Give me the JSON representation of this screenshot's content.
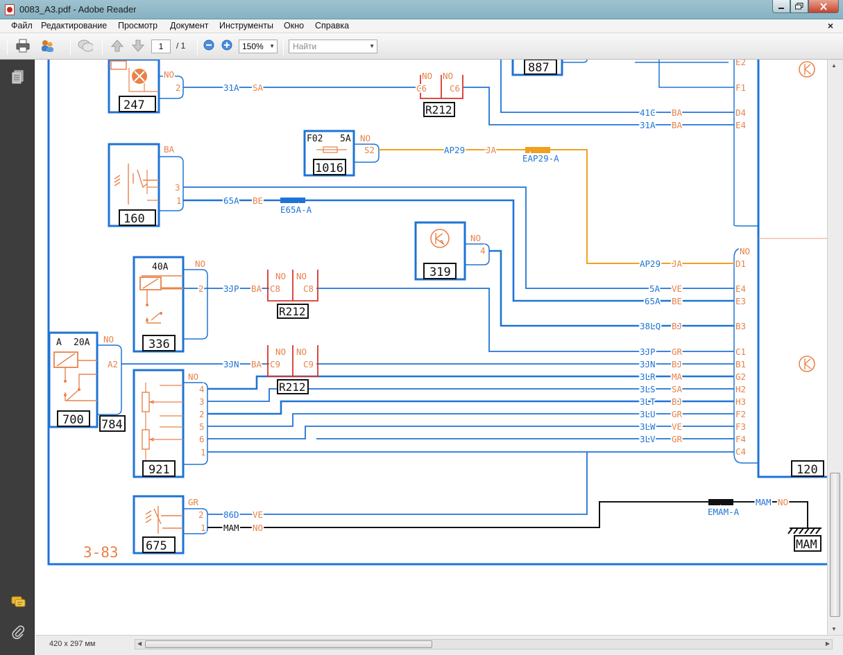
{
  "window": {
    "title": "0083_A3.pdf - Adobe Reader"
  },
  "menu": {
    "items": [
      "Файл",
      "Редактирование",
      "Просмотр",
      "Документ",
      "Инструменты",
      "Окно",
      "Справка"
    ],
    "close_glyph": "×"
  },
  "toolbar": {
    "page_current": "1",
    "page_total": "/ 1",
    "zoom": "150%",
    "search_placeholder": "Найти"
  },
  "status": {
    "page_size": "420 x 297 мм"
  },
  "colors": {
    "blue": "#1e73d6",
    "orange": "#e8824a",
    "wire_orange": "#f0a020",
    "black": "#111111"
  },
  "diagram": {
    "sheet_ref": "3-83",
    "components": [
      {
        "id": "247",
        "label": "247"
      },
      {
        "id": "160",
        "label": "160"
      },
      {
        "id": "1016",
        "label": "1016",
        "fuse": "F02",
        "rating": "5A"
      },
      {
        "id": "319",
        "label": "319"
      },
      {
        "id": "336",
        "label": "336",
        "rating": "40A"
      },
      {
        "id": "700",
        "label": "700",
        "top_left": "A",
        "rating": "20A"
      },
      {
        "id": "784",
        "label": "784"
      },
      {
        "id": "921",
        "label": "921"
      },
      {
        "id": "675",
        "label": "675"
      },
      {
        "id": "887",
        "label": "887"
      },
      {
        "id": "120",
        "label": "120"
      },
      {
        "id": "MAM",
        "label": "MAM"
      }
    ],
    "connectors": [
      {
        "id": "R212-C6",
        "label": "R212",
        "pins": [
          "C6",
          "C6"
        ],
        "colors": [
          "NO",
          "NO"
        ]
      },
      {
        "id": "R212-C8",
        "label": "R212",
        "pins": [
          "C8",
          "C8"
        ],
        "colors": [
          "NO",
          "NO"
        ]
      },
      {
        "id": "R212-C9",
        "label": "R212",
        "pins": [
          "C9",
          "C9"
        ],
        "colors": [
          "NO",
          "NO"
        ]
      }
    ],
    "wires": [
      {
        "code": "31A",
        "color": "SA",
        "to": "E4"
      },
      {
        "code": "41C",
        "color": "BA",
        "to": "D4"
      },
      {
        "code": "31A",
        "color": "BA",
        "to": "E4"
      },
      {
        "code": "AP29",
        "color": "JA",
        "splice": "EAP29-A"
      },
      {
        "code": "65A",
        "color": "BE",
        "splice": "E65A-A"
      },
      {
        "code": "AP29",
        "color": "JA",
        "to": "D1"
      },
      {
        "code": "5A",
        "color": "VE",
        "to": "E4"
      },
      {
        "code": "65A",
        "color": "BE",
        "to": "E3"
      },
      {
        "code": "38LQ",
        "color": "BJ",
        "to": "B3"
      },
      {
        "code": "3JP",
        "color": "GR",
        "to": "C1"
      },
      {
        "code": "3JN",
        "color": "BJ",
        "to": "B1"
      },
      {
        "code": "3LR",
        "color": "MA",
        "to": "G2"
      },
      {
        "code": "3LS",
        "color": "SA",
        "to": "H2"
      },
      {
        "code": "3LT",
        "color": "BJ",
        "to": "H3"
      },
      {
        "code": "3LU",
        "color": "GR",
        "to": "F2"
      },
      {
        "code": "3LW",
        "color": "VE",
        "to": "F3"
      },
      {
        "code": "3LV",
        "color": "GR",
        "to": "F4"
      },
      {
        "code": "86D",
        "color": "VE"
      },
      {
        "code": "MAM",
        "color": "NO"
      },
      {
        "code": "MAM",
        "color": "NO",
        "splice": "EMAM-A"
      }
    ],
    "pin_labels": {
      "ecu_pins": [
        "E2",
        "F1",
        "D4",
        "E4",
        "D1",
        "E4",
        "E3",
        "B3",
        "C1",
        "B1",
        "G2",
        "H2",
        "H3",
        "F2",
        "F3",
        "F4",
        "C4"
      ],
      "wire_colors_misc": [
        "NO",
        "BA",
        "GR",
        "NO",
        "NO",
        "NO",
        "NO",
        "NO"
      ],
      "pin_numbers": [
        "2",
        "3",
        "1",
        "2",
        "A2",
        "4",
        "4",
        "3",
        "2",
        "5",
        "6",
        "1",
        "2",
        "1",
        "S2"
      ],
      "small_codes": [
        "3JP",
        "BA",
        "3JN",
        "BA"
      ]
    }
  }
}
